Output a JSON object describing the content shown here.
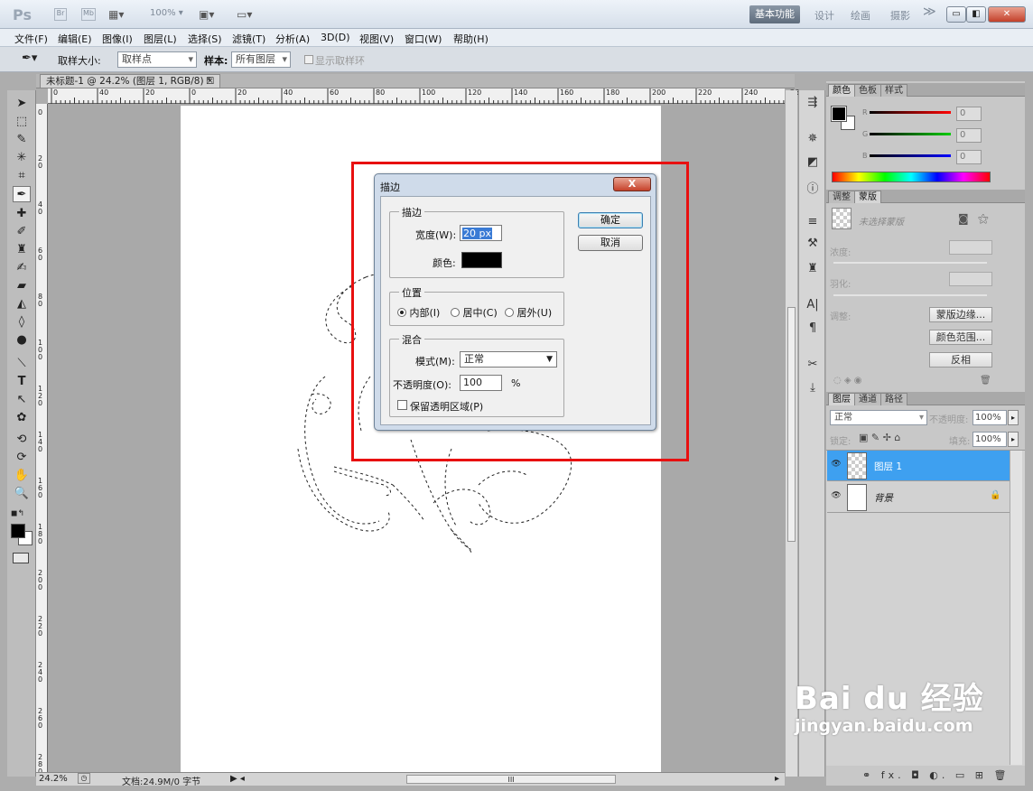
{
  "app": {
    "logo": "Ps",
    "zoom_dropdown": "100%"
  },
  "workspaces": {
    "active": "基本功能",
    "items": [
      "设计",
      "绘画",
      "摄影"
    ],
    "more": "≫"
  },
  "menu": [
    "文件(F)",
    "编辑(E)",
    "图像(I)",
    "图层(L)",
    "选择(S)",
    "滤镜(T)",
    "分析(A)",
    "3D(D)",
    "视图(V)",
    "窗口(W)",
    "帮助(H)"
  ],
  "options": {
    "sample_size_label": "取样大小:",
    "sample_size_value": "取样点",
    "sample_label": "样本:",
    "sample_value": "所有图层",
    "show_ring_label": "显示取样环"
  },
  "document": {
    "tab_title": "未标题-1 @ 24.2% (图层 1, RGB/8) *",
    "close": "☒"
  },
  "ruler": {
    "h_labels": [
      "0",
      "40",
      "20",
      "0",
      "20",
      "40",
      "60",
      "80",
      "100",
      "120",
      "140",
      "160",
      "180",
      "200",
      "220",
      "240",
      "26"
    ],
    "v_labels": [
      "0",
      "2 0",
      "4 0",
      "6 0",
      "8 0",
      "1 0 0",
      "1 2 0",
      "1 4 0",
      "1 6 0",
      "1 8 0",
      "2 0 0",
      "2 2 0",
      "2 4 0",
      "2 6 0",
      "2 8 0"
    ]
  },
  "status": {
    "zoom": "24.2%",
    "doc_info": "文档:24.9M/0 字节",
    "scroll_center": "III"
  },
  "dialog": {
    "title": "描边",
    "close": "X",
    "stroke_group": "描边",
    "width_label": "宽度(W):",
    "width_value": "20 px",
    "color_label": "颜色:",
    "color_value": "#000000",
    "ok": "确定",
    "cancel": "取消",
    "position_group": "位置",
    "positions": [
      "内部(I)",
      "居中(C)",
      "居外(U)"
    ],
    "position_selected": 0,
    "blend_group": "混合",
    "mode_label": "模式(M):",
    "mode_value": "正常",
    "opacity_label": "不透明度(O):",
    "opacity_value": "100",
    "opacity_unit": "%",
    "preserve_label": "保留透明区域(P)"
  },
  "panels": {
    "color_tabs": [
      "颜色",
      "色板",
      "样式"
    ],
    "channels": [
      {
        "label": "R",
        "value": "0",
        "color": "#d02020"
      },
      {
        "label": "G",
        "value": "0",
        "color": "#20a020"
      },
      {
        "label": "B",
        "value": "0",
        "color": "#2040d0"
      }
    ],
    "adjust_tabs": [
      "调整",
      "蒙版"
    ],
    "mask_label": "未选择蒙版",
    "density_label": "浓度:",
    "feather_label": "羽化:",
    "refine_label": "调整:",
    "mask_edge_btn": "蒙版边缘...",
    "color_range_btn": "颜色范围...",
    "invert_btn": "反相",
    "layer_tabs": [
      "图层",
      "通道",
      "路径"
    ],
    "blend_mode": "正常",
    "opacity_label": "不透明度:",
    "opacity_value": "100%",
    "lock_label": "锁定:",
    "fill_label": "填充:",
    "fill_value": "100%",
    "layers": [
      {
        "name": "图层 1",
        "selected": true
      },
      {
        "name": "背景",
        "selected": false
      }
    ],
    "bottom_icons": "⚭ fx. ◘ ◐. ▭ ⊞ 🗑"
  },
  "watermark": {
    "logo": "Bai du 经验",
    "url": "jingyan.baidu.com"
  }
}
